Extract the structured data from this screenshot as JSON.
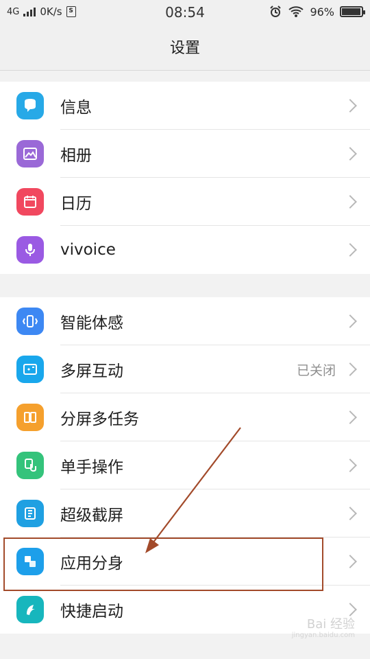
{
  "status_bar": {
    "network": "4G",
    "speed": "0K/s",
    "sim_label": "S",
    "time": "08:54",
    "battery_text": "96%",
    "battery_level": 0.96
  },
  "header": {
    "title": "设置"
  },
  "section_top": [
    {
      "label": "信息",
      "icon": "message-icon",
      "color": "#27a9e7",
      "value": ""
    },
    {
      "label": "相册",
      "icon": "image-icon",
      "color": "#9a69d7",
      "value": ""
    },
    {
      "label": "日历",
      "icon": "calendar-icon",
      "color": "#f1485f",
      "value": ""
    },
    {
      "label": "vivoice",
      "icon": "microphone-icon",
      "color": "#9a5ae3",
      "value": ""
    }
  ],
  "section_bottom": [
    {
      "label": "智能体感",
      "icon": "phone-motion-icon",
      "color": "#3d88f3",
      "value": ""
    },
    {
      "label": "多屏互动",
      "icon": "screen-share-icon",
      "color": "#19a7ec",
      "value": "已关闭"
    },
    {
      "label": "分屏多任务",
      "icon": "split-screen-icon",
      "color": "#f5a02d",
      "value": ""
    },
    {
      "label": "单手操作",
      "icon": "one-hand-icon",
      "color": "#34c37b",
      "value": ""
    },
    {
      "label": "超级截屏",
      "icon": "screenshot-icon",
      "color": "#1fa0e2",
      "value": ""
    },
    {
      "label": "应用分身",
      "icon": "app-clone-icon",
      "color": "#1d9fea",
      "value": ""
    },
    {
      "label": "快捷启动",
      "icon": "quick-launch-icon",
      "color": "#17b6bd",
      "value": ""
    }
  ],
  "watermark": {
    "line1": "Bai 经验",
    "line2": "jingyan.baidu.com"
  },
  "colors": {
    "annotation": "#a24a2a",
    "chevron": "#b8b8b8"
  }
}
